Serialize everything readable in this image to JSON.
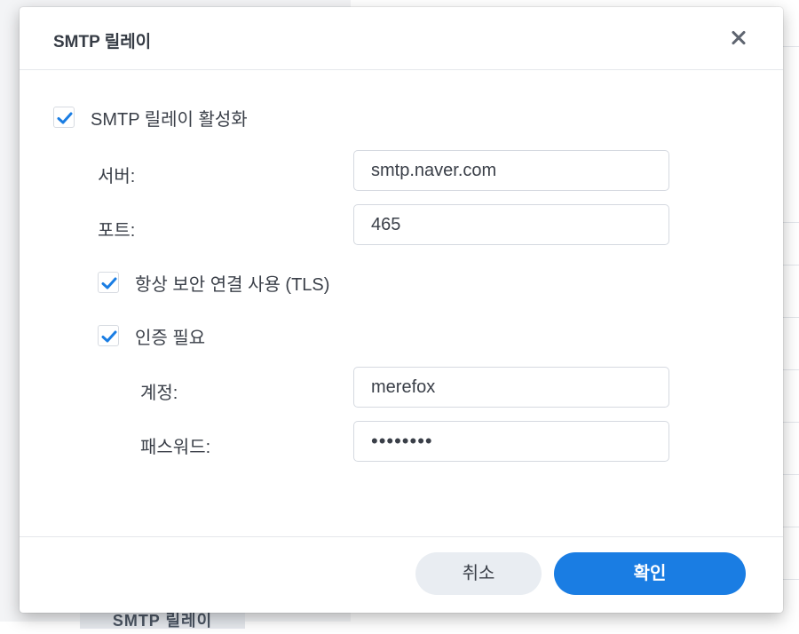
{
  "dialog": {
    "title": "SMTP 릴레이",
    "close_icon": "close-icon"
  },
  "enable": {
    "label": "SMTP 릴레이 활성화",
    "checked": true
  },
  "server": {
    "label": "서버:",
    "value": "smtp.naver.com"
  },
  "port": {
    "label": "포트:",
    "value": "465"
  },
  "tls": {
    "label": "항상 보안 연결 사용 (TLS)",
    "checked": true
  },
  "auth": {
    "label": "인증 필요",
    "checked": true
  },
  "account": {
    "label": "계정:",
    "value": "merefox"
  },
  "password": {
    "label": "패스워드:",
    "value": "••••••••"
  },
  "buttons": {
    "cancel": "취소",
    "ok": "확인"
  },
  "background": {
    "tab_label": "SMTP 릴레이"
  },
  "colors": {
    "accent": "#1a7de3",
    "check": "#1a7de3"
  }
}
